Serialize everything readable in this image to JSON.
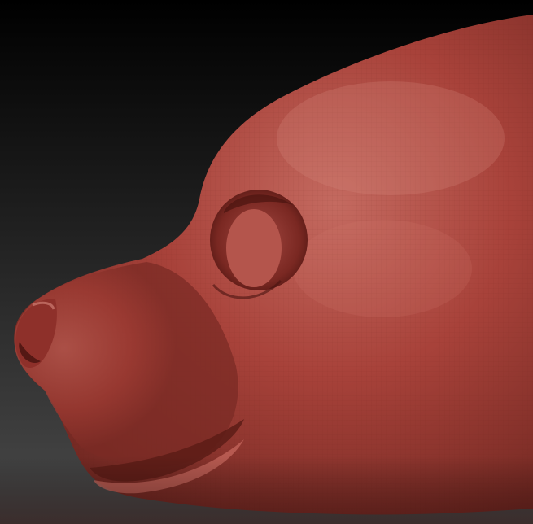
{
  "scene": {
    "subject": "sculpted-animal-head-profile",
    "background_top": "#000000",
    "background_bottom": "#4a4a4a",
    "material_base": "#a8423a",
    "material_highlight": "#c46a60",
    "material_shadow": "#5c1c16",
    "wireframe_color": "#6e2620"
  }
}
